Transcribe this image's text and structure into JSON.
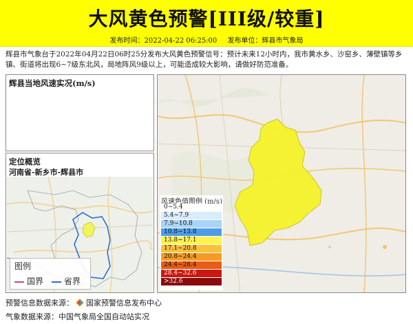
{
  "header": {
    "title": "大风黄色预警[III级/较重]",
    "publish_time_label": "发布时间：2022-04-22 06:25:00",
    "publisher_label": "发布单位：辉县市气象局",
    "bg_color": "#ffff00"
  },
  "description": "辉县市气象台于2022年04月22日06时25分发布大风黄色预警信号：预计未来12小时内，我市黄水乡、沙窑乡、薄壁镇等乡镇、街道将出现6~7级东北风，局地阵风9级以上，可能造成较大影响，请做好防范准备。",
  "wind_panel": {
    "title": "辉县当地风速实况(m/s)"
  },
  "overview_panel": {
    "title": "定位概览",
    "subtitle": "河南省-新乡市-辉县市",
    "legend": {
      "title": "图例",
      "items": [
        {
          "label": "国界",
          "color": "#c0506a"
        },
        {
          "label": "省界",
          "color": "#2a6fd6"
        }
      ]
    }
  },
  "wind_legend": {
    "title": "风速色值图例 (m/s)",
    "items": [
      {
        "label": "0~5.4",
        "color": "#ffffff"
      },
      {
        "label": "5.4~7.9",
        "color": "#d9ecfb"
      },
      {
        "label": "7.9~10.8",
        "color": "#a9d4f6"
      },
      {
        "label": "10.8~13.8",
        "color": "#4d9de6"
      },
      {
        "label": "13.8~17.1",
        "color": "#fff34f"
      },
      {
        "label": "17.1~20.8",
        "color": "#f8c23a"
      },
      {
        "label": "20.8~24.4",
        "color": "#f49b23"
      },
      {
        "label": "24.4~28.4",
        "color": "#ea5b13"
      },
      {
        "label": "28.4~32.6",
        "color": "#c9180f"
      },
      {
        "label": ">32.6",
        "color": "#8a0b0b"
      }
    ]
  },
  "footer": {
    "warning_source": "预警信息数据来源：",
    "warning_source_name": "国家预警信息发布中心",
    "weather_source": "气象数据来源：中国气象局全国自动站实况"
  }
}
